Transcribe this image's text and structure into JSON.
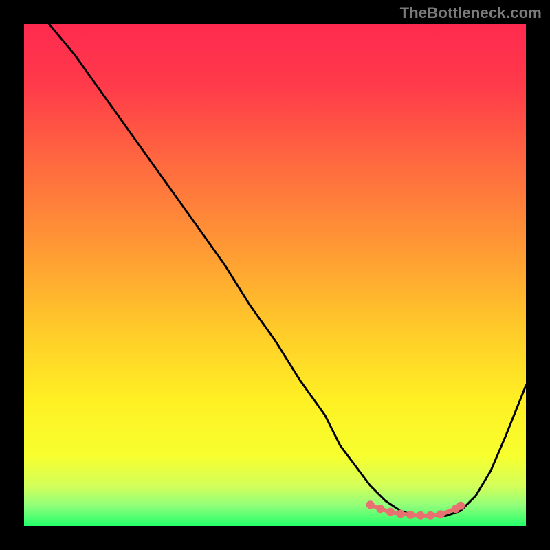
{
  "watermark": "TheBottleneck.com",
  "colors": {
    "background": "#000000",
    "curve": "#000000",
    "markers": "#e87070",
    "gradient_top": "#ff2a4f",
    "gradient_mid": "#ffe728",
    "gradient_bottom": "#23ff6a"
  },
  "chart_data": {
    "type": "line",
    "title": "",
    "xlabel": "",
    "ylabel": "",
    "xlim": [
      0,
      100
    ],
    "ylim": [
      0,
      100
    ],
    "series": [
      {
        "name": "bottleneck-curve",
        "x": [
          5,
          10,
          15,
          20,
          25,
          30,
          35,
          40,
          45,
          50,
          55,
          60,
          63,
          66,
          69,
          72,
          75,
          78,
          81,
          84,
          87,
          90,
          93,
          96,
          100
        ],
        "y": [
          100,
          94,
          87,
          80,
          73,
          66,
          59,
          52,
          44,
          37,
          29,
          22,
          16,
          12,
          8,
          5,
          3,
          2,
          2,
          2,
          3,
          6,
          11,
          18,
          28
        ]
      }
    ],
    "markers": {
      "name": "optimal-range",
      "x": [
        69,
        71,
        73,
        75,
        77,
        79,
        81,
        83,
        86,
        87
      ],
      "y": [
        4.2,
        3.4,
        2.8,
        2.4,
        2.2,
        2.1,
        2.1,
        2.3,
        3.4,
        4.0
      ]
    }
  }
}
